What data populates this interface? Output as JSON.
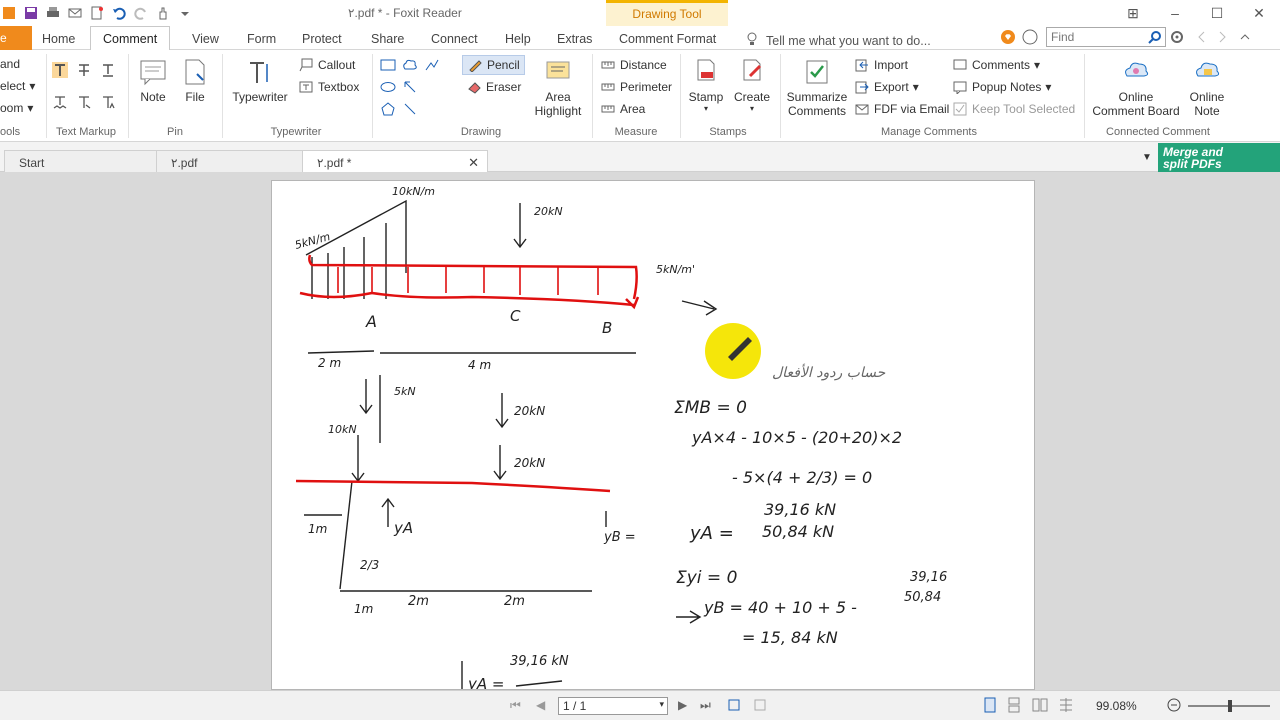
{
  "window": {
    "title": "٢.pdf * - Foxit Reader",
    "context_tab": "Drawing Tool"
  },
  "tabs": {
    "file": "e",
    "items": [
      "Home",
      "Comment",
      "View",
      "Form",
      "Protect",
      "Share",
      "Connect",
      "Help",
      "Extras",
      "Comment Format"
    ],
    "active": "Comment",
    "tell_me": "Tell me what you want to do...",
    "find_placeholder": "Find"
  },
  "ribbon": {
    "tools_group": {
      "items": [
        "and",
        "elect",
        "oom"
      ],
      "label": "ools"
    },
    "text_markup": {
      "label": "Text Markup"
    },
    "pin": {
      "note": "Note",
      "file": "File",
      "label": "Pin"
    },
    "typewriter": {
      "typewriter": "Typewriter",
      "callout": "Callout",
      "textbox": "Textbox",
      "label": "Typewriter"
    },
    "drawing": {
      "pencil": "Pencil",
      "eraser": "Eraser",
      "area_highlight_1": "Area",
      "area_highlight_2": "Highlight",
      "label": "Drawing"
    },
    "measure": {
      "distance": "Distance",
      "perimeter": "Perimeter",
      "area": "Area",
      "label": "Measure"
    },
    "stamps": {
      "stamp": "Stamp",
      "create": "Create",
      "label": "Stamps"
    },
    "manage": {
      "summarize_1": "Summarize",
      "summarize_2": "Comments",
      "import": "Import",
      "export": "Export",
      "fdf": "FDF via Email",
      "comments": "Comments",
      "popup": "Popup Notes",
      "keep": "Keep Tool Selected",
      "label": "Manage Comments"
    },
    "connected": {
      "board_1": "Online",
      "board_2": "Comment Board",
      "note_1": "Online",
      "note_2": "Note",
      "label": "Connected Comment"
    }
  },
  "doc_tabs": [
    "Start",
    "٢.pdf",
    "٢.pdf *"
  ],
  "merge_banner": [
    "Merge and",
    "split PDFs"
  ],
  "status": {
    "page": "1 / 1",
    "zoom": "99.08%"
  },
  "handwriting": {
    "load_top": "10kN/m",
    "load_left": "5kN/m",
    "force_20": "20kN",
    "point_a": "A",
    "point_c": "C",
    "point_b": "B",
    "dim_2m": "2 m",
    "dim_4m": "4 m",
    "load_right": "5kN/m'",
    "arabic_note": "حساب ردود الأفعال",
    "eq_moment": "ΣMB = 0",
    "eq_line1": "yA×4 - 10×5 - (20+20)×2",
    "eq_line2": "- 5×(4 + 2/3) = 0",
    "ya_val_new": "39,16 kN",
    "ya_label": "yA =",
    "ya_val_old": "50,84 kN",
    "eq_sum": "Σyi = 0",
    "eq_yb": "yB = 40 + 10 + 5 -",
    "eq_yb_old": "50,84",
    "eq_yb_new": "39,16",
    "eq_yb_res": "= 15, 84 kN",
    "fbd_5kn": "5kN",
    "fbd_10kn": "10kN",
    "fbd_20kn_a": "20kN",
    "fbd_20kn_b": "20kN",
    "fbd_ya": "yA",
    "fbd_yb": "yB =",
    "frac": "2/3",
    "dim_1m": "1m",
    "dim_1m_b": "1m",
    "dim_2m_b": "2m",
    "dim_2m_c": "2m",
    "bottom_val": "39,16 kN",
    "bottom_ya": "yA ="
  },
  "colors": {
    "accent_orange": "#f08a1c",
    "red_pencil": "#e01010",
    "cursor_yellow": "#f5e60a",
    "banner_green": "#23a37a"
  }
}
